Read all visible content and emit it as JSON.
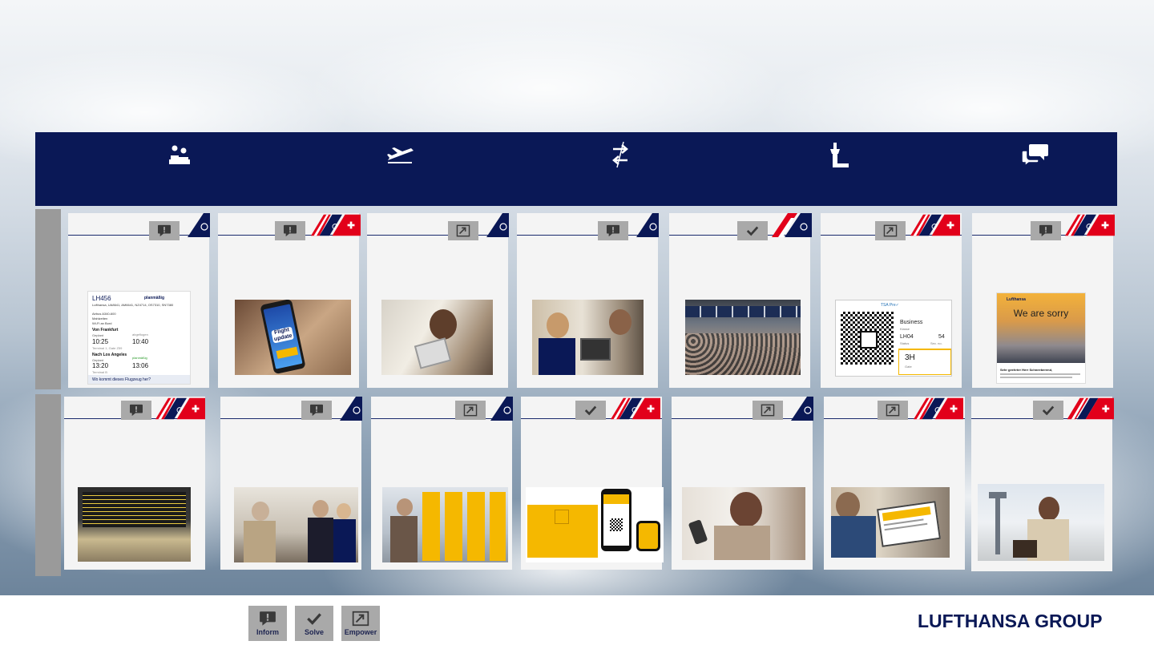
{
  "header_icons": [
    "check-in-counter-icon",
    "departing-plane-icon",
    "transfer-arrows-icon",
    "control-tower-icon",
    "speech-bubbles-icon"
  ],
  "badge_types": {
    "inform": "info-message-icon",
    "solve": "checkmark-icon",
    "empower": "external-link-icon"
  },
  "legend": {
    "inform": "Inform",
    "solve": "Solve",
    "empower": "Empower"
  },
  "logo": "LUFTHANSA GROUP",
  "colors": {
    "navy": "#0a1856",
    "gray_badge": "#a9a9a9",
    "yellow": "#f5b800",
    "swiss_red": "#e2001a"
  },
  "card_lh456": {
    "flight": "LH456",
    "status": "planmäßig",
    "codeshare": "Lufthansa, UA8641, AM6641, NZ4714, OS7310, SN7380",
    "aircraft": "Airbus A340-600",
    "meals": "Mahlzeiten",
    "wifi": "Wi-Fi an Bord",
    "from": "Von Frankfurt",
    "departed": "abgeflogen",
    "planned1": "Geplant",
    "time_planned1": "10:25",
    "time_actual1": "10:40",
    "terminal1": "Terminal 1, Gate Z59",
    "to": "Nach Los Angeles",
    "arrival_status": "planmäßig",
    "planned2": "Geplant",
    "time_planned2": "13:20",
    "time_actual2": "13:06",
    "terminal2": "Terminal B",
    "link": "Wo kommt dieses Flugzeug her?"
  },
  "card_flight_update": {
    "text": "Flight update"
  },
  "card_boarding": {
    "tsa": "TSA Pre✓",
    "class": "Business",
    "class_sub": "Klasse",
    "flight": "LH04",
    "flight_sub": "Status",
    "seat": "54",
    "seat_sub": "Sec. no.",
    "gate": "3H",
    "gate_sub": "Gate"
  },
  "card_sorry": {
    "brand": "Lufthansa",
    "headline": "We are sorry",
    "greeting": "Sehr geehrter Herr Schneeberend,"
  },
  "row1": [
    {
      "badge": "inform",
      "tail": "lh"
    },
    {
      "badge": "inform",
      "tail": "group"
    },
    {
      "badge": "empower",
      "tail": "lh"
    },
    {
      "badge": "inform",
      "tail": "lh"
    },
    {
      "badge": "solve",
      "tail": "austrian"
    },
    {
      "badge": "empower",
      "tail": "group"
    },
    {
      "badge": "inform",
      "tail": "group"
    }
  ],
  "row2": [
    {
      "badge": "inform",
      "tail": "group"
    },
    {
      "badge": "inform",
      "tail": "lh"
    },
    {
      "badge": "empower",
      "tail": "lh"
    },
    {
      "badge": "solve",
      "tail": "group"
    },
    {
      "badge": "empower",
      "tail": "lh"
    },
    {
      "badge": "empower",
      "tail": "group"
    },
    {
      "badge": "solve",
      "tail": "swiss"
    }
  ]
}
